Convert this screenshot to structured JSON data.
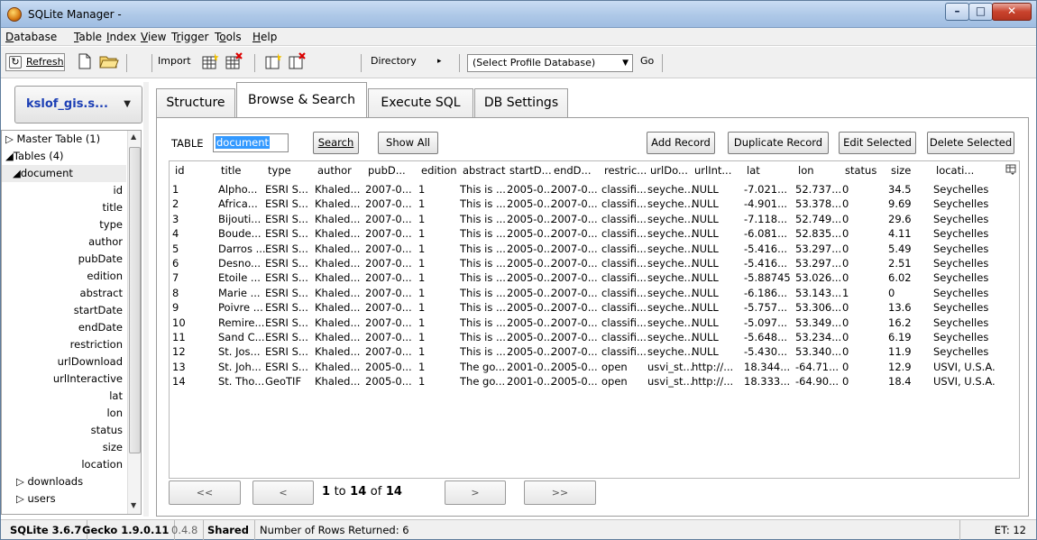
{
  "window": {
    "title": "SQLite Manager - "
  },
  "menu": [
    {
      "label": "Database",
      "u": "D"
    },
    {
      "label": "Table",
      "u": "T"
    },
    {
      "label": "Index",
      "u": "I"
    },
    {
      "label": "View",
      "u": "V"
    },
    {
      "label": "Trigger",
      "u": "r"
    },
    {
      "label": "Tools",
      "u": "o"
    },
    {
      "label": "Help",
      "u": "H"
    }
  ],
  "toolbar": {
    "refresh": "Refresh",
    "import": "Import",
    "directory": "Directory",
    "directory_arrow": "▸",
    "profile_select": "(Select Profile Database)",
    "go": "Go"
  },
  "sidebar": {
    "db_name": "kslof_gis.s...",
    "tree": [
      {
        "text": "▷ Master Table (1)",
        "level": 0
      },
      {
        "text": "◢Tables (4)",
        "level": 0
      },
      {
        "text": "◢document",
        "level": 1,
        "selected": true
      },
      {
        "text": "id",
        "level": 2
      },
      {
        "text": "title",
        "level": 2
      },
      {
        "text": "type",
        "level": 2
      },
      {
        "text": "author",
        "level": 2
      },
      {
        "text": "pubDate",
        "level": 2
      },
      {
        "text": "edition",
        "level": 2
      },
      {
        "text": "abstract",
        "level": 2
      },
      {
        "text": "startDate",
        "level": 2
      },
      {
        "text": "endDate",
        "level": 2
      },
      {
        "text": "restriction",
        "level": 2
      },
      {
        "text": "urlDownload",
        "level": 2
      },
      {
        "text": "urlInteractive",
        "level": 2
      },
      {
        "text": "lat",
        "level": 2
      },
      {
        "text": "lon",
        "level": 2
      },
      {
        "text": "status",
        "level": 2
      },
      {
        "text": "size",
        "level": 2
      },
      {
        "text": "location",
        "level": 2
      },
      {
        "text": "▷ downloads",
        "level": 1
      },
      {
        "text": "▷ users",
        "level": 1
      }
    ]
  },
  "tabs": [
    {
      "label": "Structure",
      "active": false
    },
    {
      "label": "Browse & Search",
      "active": true
    },
    {
      "label": "Execute SQL",
      "active": false
    },
    {
      "label": "DB Settings",
      "active": false
    }
  ],
  "browse": {
    "table_label": "TABLE",
    "table_value": "document",
    "search": "Search",
    "show_all": "Show All",
    "add_record": "Add Record",
    "duplicate_record": "Duplicate Record",
    "edit_selected": "Edit Selected",
    "delete_selected": "Delete Selected"
  },
  "grid": {
    "columns": [
      "id",
      "title",
      "type",
      "author",
      "pubD...",
      "edition",
      "abstract",
      "startD...",
      "endD...",
      "restric...",
      "urlDo...",
      "urlInt...",
      "lat",
      "lon",
      "status",
      "size",
      "locati..."
    ],
    "picker_icon": "column-picker-icon",
    "rows": [
      [
        "1",
        "Alpho...",
        "ESRI S...",
        "Khaled...",
        "2007-0...",
        "1",
        "This is ...",
        "2005-0...",
        "2007-0...",
        "classifi...",
        "seyche...",
        "NULL",
        "-7.021...",
        "52.737...",
        "0",
        "34.5",
        "Seychelles"
      ],
      [
        "2",
        "Africa...",
        "ESRI S...",
        "Khaled...",
        "2007-0...",
        "1",
        "This is ...",
        "2005-0...",
        "2007-0...",
        "classifi...",
        "seyche...",
        "NULL",
        "-4.901...",
        "53.378...",
        "0",
        "9.69",
        "Seychelles"
      ],
      [
        "3",
        "Bijouti...",
        "ESRI S...",
        "Khaled...",
        "2007-0...",
        "1",
        "This is ...",
        "2005-0...",
        "2007-0...",
        "classifi...",
        "seyche...",
        "NULL",
        "-7.118...",
        "52.749...",
        "0",
        "29.6",
        "Seychelles"
      ],
      [
        "4",
        "Boude...",
        "ESRI S...",
        "Khaled...",
        "2007-0...",
        "1",
        "This is ...",
        "2005-0...",
        "2007-0...",
        "classifi...",
        "seyche...",
        "NULL",
        "-6.081...",
        "52.835...",
        "0",
        "4.11",
        "Seychelles"
      ],
      [
        "5",
        "Darros ...",
        "ESRI S...",
        "Khaled...",
        "2007-0...",
        "1",
        "This is ...",
        "2005-0...",
        "2007-0...",
        "classifi...",
        "seyche...",
        "NULL",
        "-5.416...",
        "53.297...",
        "0",
        "5.49",
        "Seychelles"
      ],
      [
        "6",
        "Desno...",
        "ESRI S...",
        "Khaled...",
        "2007-0...",
        "1",
        "This is ...",
        "2005-0...",
        "2007-0...",
        "classifi...",
        "seyche...",
        "NULL",
        "-5.416...",
        "53.297...",
        "0",
        "2.51",
        "Seychelles"
      ],
      [
        "7",
        "Etoile ...",
        "ESRI S...",
        "Khaled...",
        "2007-0...",
        "1",
        "This is ...",
        "2005-0...",
        "2007-0...",
        "classifi...",
        "seyche...",
        "NULL",
        "-5.88745",
        "53.026...",
        "0",
        "6.02",
        "Seychelles"
      ],
      [
        "8",
        "Marie ...",
        "ESRI S...",
        "Khaled...",
        "2007-0...",
        "1",
        "This is ...",
        "2005-0...",
        "2007-0...",
        "classifi...",
        "seyche...",
        "NULL",
        "-6.186...",
        "53.143...",
        "1",
        "0",
        "Seychelles"
      ],
      [
        "9",
        "Poivre ...",
        "ESRI S...",
        "Khaled...",
        "2007-0...",
        "1",
        "This is ...",
        "2005-0...",
        "2007-0...",
        "classifi...",
        "seyche...",
        "NULL",
        "-5.757...",
        "53.306...",
        "0",
        "13.6",
        "Seychelles"
      ],
      [
        "10",
        "Remire...",
        "ESRI S...",
        "Khaled...",
        "2007-0...",
        "1",
        "This is ...",
        "2005-0...",
        "2007-0...",
        "classifi...",
        "seyche...",
        "NULL",
        "-5.097...",
        "53.349...",
        "0",
        "16.2",
        "Seychelles"
      ],
      [
        "11",
        "Sand C...",
        "ESRI S...",
        "Khaled...",
        "2007-0...",
        "1",
        "This is ...",
        "2005-0...",
        "2007-0...",
        "classifi...",
        "seyche...",
        "NULL",
        "-5.648...",
        "53.234...",
        "0",
        "6.19",
        "Seychelles"
      ],
      [
        "12",
        "St. Jos...",
        "ESRI S...",
        "Khaled...",
        "2007-0...",
        "1",
        "This is ...",
        "2005-0...",
        "2007-0...",
        "classifi...",
        "seyche...",
        "NULL",
        "-5.430...",
        "53.340...",
        "0",
        "11.9",
        "Seychelles"
      ],
      [
        "13",
        "St. Joh...",
        "ESRI S...",
        "Khaled...",
        "2005-0...",
        "1",
        "The go...",
        "2001-0...",
        "2005-0...",
        "open",
        "usvi_st...",
        "http://...",
        "18.344...",
        "-64.71...",
        "0",
        "12.9",
        "USVI, U.S.A."
      ],
      [
        "14",
        "St. Tho...",
        "GeoTIF",
        "Khaled...",
        "2005-0...",
        "1",
        "The go...",
        "2001-0...",
        "2005-0...",
        "open",
        "usvi_st...",
        "http://...",
        "18.333...",
        "-64.90...",
        "0",
        "18.4",
        "USVI, U.S.A."
      ]
    ]
  },
  "pager": {
    "first": "<<",
    "prev": "<",
    "from": "1",
    "to_word": "to",
    "to": "14",
    "of_word": "of",
    "total": "14",
    "next": ">",
    "last": ">>"
  },
  "status": {
    "sqlite": "SQLite 3.6.7",
    "gecko": "Gecko 1.9.0.11",
    "version": "0.4.8",
    "shared": "Shared",
    "rows_returned": "Number of Rows Returned: 6",
    "et": "ET: 12"
  }
}
